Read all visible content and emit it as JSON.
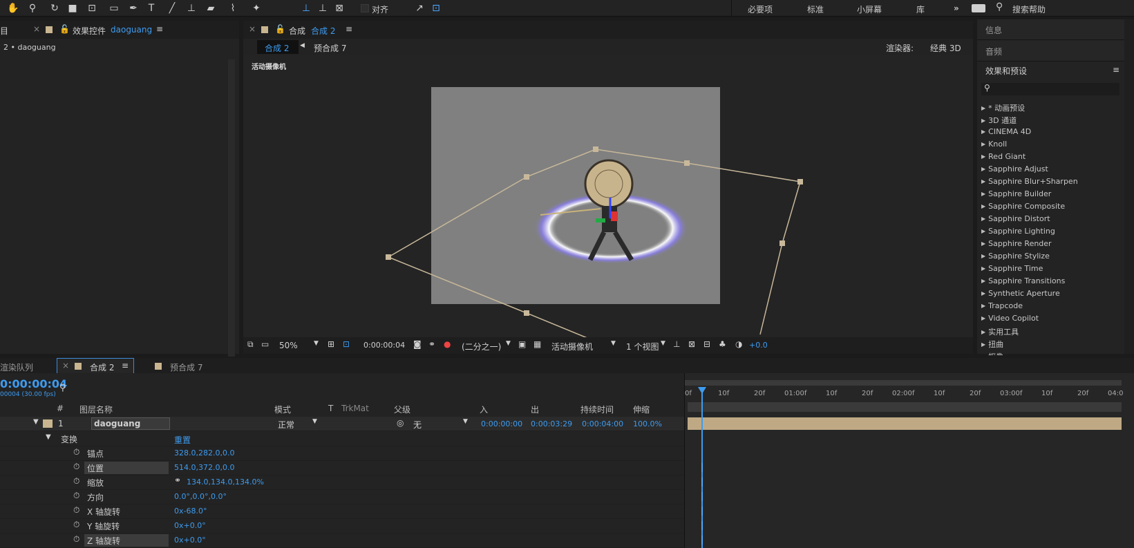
{
  "toolbar": {
    "align_label": "对齐",
    "workspaces": [
      "必要项",
      "标准",
      "小屏幕",
      "库"
    ],
    "search_help": "搜索帮助"
  },
  "left_panel": {
    "tab_partial": "目",
    "tab_label": "效果控件",
    "tab_layer": "daoguang",
    "breadcrumb": "2 • daoguang"
  },
  "comp_panel": {
    "tab_label": "合成",
    "tab_name": "合成 2",
    "breadcrumb_active": "合成 2",
    "breadcrumb_next": "预合成 7",
    "renderer_label": "渲染器:",
    "renderer_value": "经典 3D",
    "camera_label": "活动摄像机"
  },
  "viewer_bar": {
    "zoom": "50%",
    "timecode": "0:00:00:04",
    "resolution": "(二分之一)",
    "camera": "活动摄像机",
    "views": "1 个视图",
    "exposure": "+0.0"
  },
  "right_panel": {
    "info": "信息",
    "audio": "音频",
    "effects_title": "效果和预设",
    "items": [
      "* 动画预设",
      "3D 通道",
      "CINEMA 4D",
      "Knoll",
      "Red Giant",
      "Sapphire Adjust",
      "Sapphire Blur+Sharpen",
      "Sapphire Builder",
      "Sapphire Composite",
      "Sapphire Distort",
      "Sapphire Lighting",
      "Sapphire Render",
      "Sapphire Stylize",
      "Sapphire Time",
      "Sapphire Transitions",
      "Synthetic Aperture",
      "Trapcode",
      "Video Copilot",
      "实用工具",
      "扭曲",
      "抠像"
    ]
  },
  "timeline": {
    "tab_render": "渲染队列",
    "tab_comp": "合成 2",
    "tab_precomp": "预合成 7",
    "timecode": "0:00:00:04",
    "fps": "00004 (30.00 fps)",
    "headers": {
      "hash": "#",
      "layer_name": "图层名称",
      "mode": "模式",
      "t": "T",
      "trkmat": "TrkMat",
      "parent": "父级",
      "in": "入",
      "out": "出",
      "duration": "持续时间",
      "stretch": "伸缩"
    },
    "layer": {
      "index": "1",
      "name": "daoguang",
      "mode": "正常",
      "parent": "无",
      "in": "0:00:00:00",
      "out": "0:00:03:29",
      "duration": "0:00:04:00",
      "stretch": "100.0%"
    },
    "transform": {
      "label": "变换",
      "reset": "重置"
    },
    "properties": [
      {
        "label": "锚点",
        "value": "328.0,282.0,0.0"
      },
      {
        "label": "位置",
        "value": "514.0,372.0,0.0"
      },
      {
        "label": "缩放",
        "value": "134.0,134.0,134.0%"
      },
      {
        "label": "方向",
        "value": "0.0°,0.0°,0.0°"
      },
      {
        "label": "X 轴旋转",
        "value": "0x-68.0°"
      },
      {
        "label": "Y 轴旋转",
        "value": "0x+0.0°"
      },
      {
        "label": "Z 轴旋转",
        "value": "0x+0.0°"
      }
    ],
    "ruler": [
      "0f",
      "10f",
      "20f",
      "01:00f",
      "10f",
      "20f",
      "02:00f",
      "10f",
      "20f",
      "03:00f",
      "10f",
      "20f",
      "04:0"
    ]
  },
  "colors": {
    "accent": "#3e9cf0",
    "layer_bar": "#bfa985",
    "label_swatch": "#c9b58f"
  }
}
